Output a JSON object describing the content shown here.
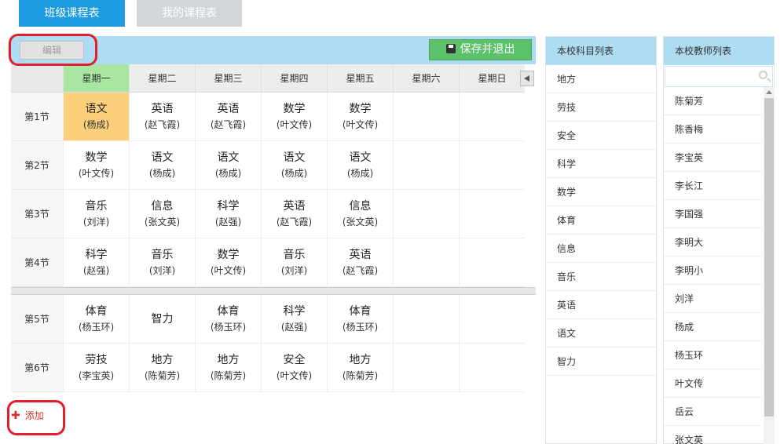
{
  "tabs": {
    "class_schedule": "班级课程表",
    "my_schedule": "我的课程表"
  },
  "toolbar": {
    "edit": "编辑",
    "save_exit": "保存并退出"
  },
  "days": [
    "星期一",
    "星期二",
    "星期三",
    "星期四",
    "星期五",
    "星期六",
    "星期日"
  ],
  "periods": [
    "第1节",
    "第2节",
    "第3节",
    "第4节",
    "第5节",
    "第6节"
  ],
  "cells": [
    [
      {
        "s": "语文",
        "t": "(杨成)"
      },
      {
        "s": "英语",
        "t": "(赵飞霞)"
      },
      {
        "s": "英语",
        "t": "(赵飞霞)"
      },
      {
        "s": "数学",
        "t": "(叶文传)"
      },
      {
        "s": "数学",
        "t": "(叶文传)"
      }
    ],
    [
      {
        "s": "数学",
        "t": "(叶文传)"
      },
      {
        "s": "语文",
        "t": "(杨成)"
      },
      {
        "s": "语文",
        "t": "(杨成)"
      },
      {
        "s": "语文",
        "t": "(杨成)"
      },
      {
        "s": "语文",
        "t": "(杨成)"
      }
    ],
    [
      {
        "s": "音乐",
        "t": "(刘洋)"
      },
      {
        "s": "信息",
        "t": "(张文英)"
      },
      {
        "s": "科学",
        "t": "(赵强)"
      },
      {
        "s": "英语",
        "t": "(赵飞霞)"
      },
      {
        "s": "信息",
        "t": "(张文英)"
      }
    ],
    [
      {
        "s": "科学",
        "t": "(赵强)"
      },
      {
        "s": "音乐",
        "t": "(刘洋)"
      },
      {
        "s": "数学",
        "t": "(叶文传)"
      },
      {
        "s": "音乐",
        "t": "(刘洋)"
      },
      {
        "s": "英语",
        "t": "(赵飞霞)"
      }
    ],
    [
      {
        "s": "体育",
        "t": "(杨玉环)"
      },
      {
        "s": "智力",
        "t": ""
      },
      {
        "s": "体育",
        "t": "(杨玉环)"
      },
      {
        "s": "科学",
        "t": "(赵强)"
      },
      {
        "s": "体育",
        "t": "(杨玉环)"
      }
    ],
    [
      {
        "s": "劳技",
        "t": "(李宝英)"
      },
      {
        "s": "地方",
        "t": "(陈菊芳)"
      },
      {
        "s": "地方",
        "t": "(陈菊芳)"
      },
      {
        "s": "安全",
        "t": "(叶文传)"
      },
      {
        "s": "地方",
        "t": "(陈菊芳)"
      }
    ]
  ],
  "add_label": "添加",
  "subjects_panel": {
    "title": "本校科目列表",
    "items": [
      "地方",
      "劳技",
      "安全",
      "科学",
      "数学",
      "体育",
      "信息",
      "音乐",
      "英语",
      "语文",
      "智力"
    ]
  },
  "teachers_panel": {
    "title": "本校教师列表",
    "items": [
      "陈菊芳",
      "陈香梅",
      "李宝英",
      "李长江",
      "李国强",
      "李明大",
      "李明小",
      "刘洋",
      "杨成",
      "杨玉环",
      "叶文传",
      "岳云",
      "张文英"
    ]
  },
  "colors": {
    "accent": "#1e9ce3",
    "header": "#aedcf2",
    "save": "#5bc26a",
    "selected_day": "#a8e6a2",
    "selected_cell": "#fccf7a",
    "highlight": "#e31d2b"
  },
  "icons": {
    "save": "floppy-disk-icon",
    "add": "plus-icon",
    "search": "search-icon",
    "scroll_left": "triangle-left-icon"
  }
}
